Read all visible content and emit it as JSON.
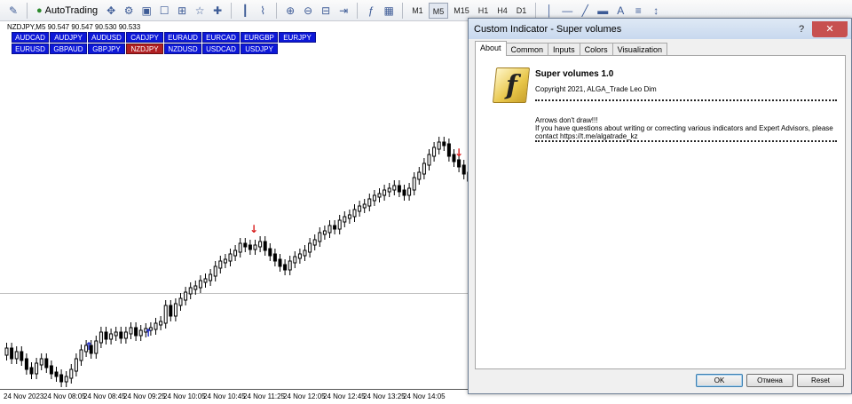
{
  "toolbar": {
    "autotrading_label": "AutoTrading",
    "timeframes": [
      "M1",
      "M5",
      "M15",
      "H1",
      "H4",
      "D1"
    ],
    "active_timeframe": "M5"
  },
  "chart": {
    "symbol_line": "NZDJPY,M5  90.547 90.547 90.530 90.533",
    "pairs_row1": [
      "AUDCAD",
      "AUDJPY",
      "AUDUSD",
      "CADJPY",
      "EURAUD",
      "EURCAD",
      "EURGBP",
      "EURJPY"
    ],
    "pairs_row2": [
      "EURUSD",
      "GBPAUD",
      "GBPJPY",
      "NZDJPY",
      "NZDUSD",
      "USDCAD",
      "USDJPY"
    ],
    "selected_pair": "NZDJPY",
    "time_labels": [
      "24 Nov 2023",
      "24 Nov 08:05",
      "24 Nov 08:45",
      "24 Nov 09:25",
      "24 Nov 10:05",
      "24 Nov 10:45",
      "24 Nov 11:25",
      "24 Nov 12:05",
      "24 Nov 12:45",
      "24 Nov 13:25",
      "24 Nov 14:05"
    ],
    "colors": {
      "pair_button": "#0d18d8",
      "pair_selected": "#b01f22",
      "up_arrow": "#1e2bc8",
      "down_arrow": "#d81e1e"
    }
  },
  "dialog": {
    "title": "Custom Indicator - Super volumes",
    "tabs": [
      "About",
      "Common",
      "Inputs",
      "Colors",
      "Visualization"
    ],
    "active_tab": "About",
    "indicator_title": "Super volumes 1.0",
    "copyright": "Copyright 2021, ALGA_Trade Leo Dim",
    "description_line1": "Arrows don't draw!!!",
    "description_line2": "If you have questions about writing or correcting various indicators and Expert Advisors, please contact https://t.me/algatrade_kz",
    "buttons": {
      "ok": "OK",
      "cancel": "Отмена",
      "reset": "Reset"
    }
  }
}
